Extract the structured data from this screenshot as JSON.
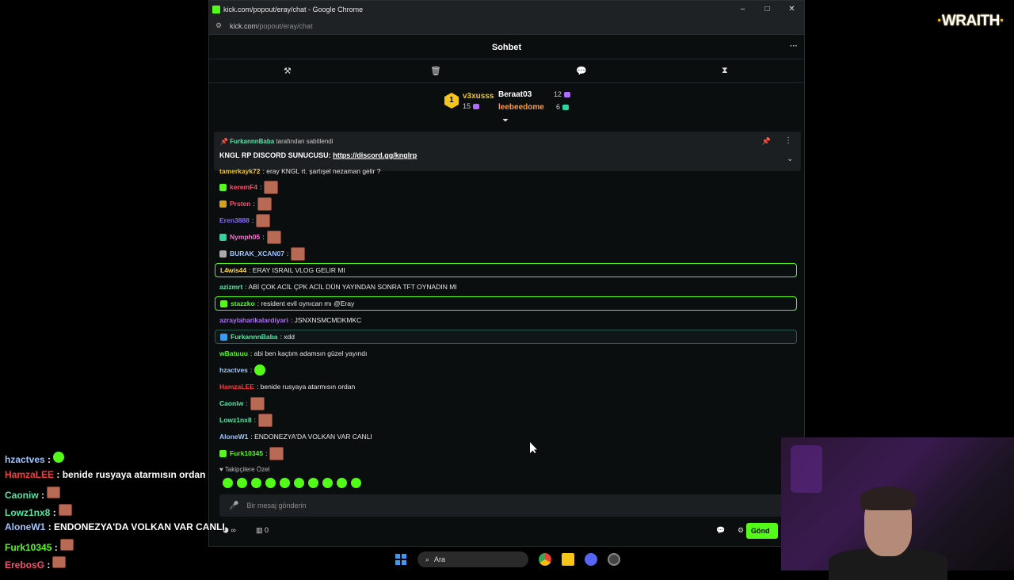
{
  "window": {
    "title": "kick.com/popout/eray/chat - Google Chrome",
    "url_host": "kick.com",
    "url_path": "/popout/eray/chat",
    "controls": [
      "–",
      "□",
      "✕"
    ]
  },
  "chat": {
    "title": "Sohbet",
    "more": "···"
  },
  "mod_icons": [
    "gavel-icon",
    "trash-icon",
    "message-icon",
    "hourglass-icon"
  ],
  "leaderboard": {
    "first": {
      "rank": "1",
      "name": "v3xusss",
      "count": "15"
    },
    "second": {
      "name": "Beraat03",
      "count": "12"
    },
    "third": {
      "name": "leebeedome",
      "count": "6"
    }
  },
  "pinned": {
    "by_user": "FurkannnBaba",
    "by_suffix": "tarafından sabitlendi",
    "message": "KNGL RP DISCORD SUNUCUSU:",
    "link": "https://discord.gg/knglrp"
  },
  "messages": [
    {
      "user": "tamerkayk72",
      "text": ": eray KNGL rt. şartışel nezaman gelir ?",
      "color": "#f5c518",
      "cut": true
    },
    {
      "user": "keremF4",
      "text": ":",
      "color": "#ff4d6d",
      "emote": true,
      "badge": "#53fc18"
    },
    {
      "user": "Prsten",
      "text": ":",
      "color": "#ff4d6d",
      "emote": true,
      "badge": "#d4a017"
    },
    {
      "user": "Eren3888",
      "text": ":",
      "color": "#8a6bff",
      "emote": true
    },
    {
      "user": "Nymph05",
      "text": ":",
      "color": "#ff6bd6",
      "emote": true,
      "badge": "#2bd4a0"
    },
    {
      "user": "BURAK_XCAN07",
      "text": ":",
      "color": "#9ec5ff",
      "emote": true,
      "badge": "#aaaaaa"
    },
    {
      "user": "L4wis44",
      "text": ": ERAY ISRAIL VLOG GELIR MI",
      "color": "#ffd84d",
      "hl": true
    },
    {
      "user": "azizmrt",
      "text": ": ABİ ÇOK ACİL ÇPK ACİL DÜN YAYINDAN SONRA TFT OYNADIN MI",
      "color": "#53e6a6"
    },
    {
      "user": "stazzko",
      "text": ": resident evil oynıcan mı @Eray",
      "color": "#53fc18",
      "hl": true,
      "badge": "#53fc18"
    },
    {
      "user": "azraylaharikalardiyari",
      "text": ": JSNXNSMCMDKMKC",
      "color": "#b06bff"
    },
    {
      "user": "FurkannnBaba",
      "text": ": xdd",
      "color": "#53e6a6",
      "hl2": true,
      "badge": "#3a9bf5"
    },
    {
      "user": "wBatuuu",
      "text": ": abi ben kaçtım adamsın güzel yayındı",
      "color": "#53fc18"
    },
    {
      "user": "hzactves",
      "text": ":",
      "color": "#9ec5ff",
      "gemote": true
    },
    {
      "user": "HamzaLEE",
      "text": ": benide rusyaya atarmısın ordan",
      "color": "#ff3b3b"
    },
    {
      "user": "Caoniw",
      "text": ":",
      "color": "#53e6a6",
      "emote": true
    },
    {
      "user": "Lowz1nx8",
      "text": ":",
      "color": "#53e6a6",
      "emote": true
    },
    {
      "user": "AloneW1",
      "text": ": ENDONEZYA'DA VOLKAN VAR CANLI",
      "color": "#9ec5ff"
    },
    {
      "user": "Furk10345",
      "text": ":",
      "color": "#53fc18",
      "emote": true,
      "badge": "#53fc18"
    }
  ],
  "followers_label": "♥ Takipçilere Özel",
  "input_placeholder": "Bir mesaj gönderin",
  "bottom": {
    "points_icon": "∞",
    "points": "0",
    "send": "Gönd"
  },
  "overlay": [
    {
      "user": "hzactves",
      "text": ":",
      "color": "#9ec5ff",
      "gemote": true
    },
    {
      "user": "HamzaLEE",
      "text": ": benide rusyaya atarmısın ordan",
      "color": "#ff3b3b"
    },
    {
      "user": "Caoniw",
      "text": ":",
      "color": "#53e6a6",
      "emote": true
    },
    {
      "user": "Lowz1nx8",
      "text": ":",
      "color": "#53e6a6",
      "emote": true
    },
    {
      "user": "AloneW1",
      "text": ": ENDONEZYA'DA VOLKAN VAR CANLI",
      "color": "#9ec5ff"
    },
    {
      "user": "Furk10345",
      "text": ":",
      "color": "#53fc18",
      "emote": true
    },
    {
      "user": "ErebosG",
      "text": ":",
      "color": "#ff4d6d",
      "emote": true
    }
  ],
  "logo": {
    "text": "WRAITH",
    "dot": "·"
  },
  "taskbar": {
    "search": "Ara"
  },
  "colors": {
    "kick_green": "#53fc18",
    "bg": "#0b0e0f"
  }
}
